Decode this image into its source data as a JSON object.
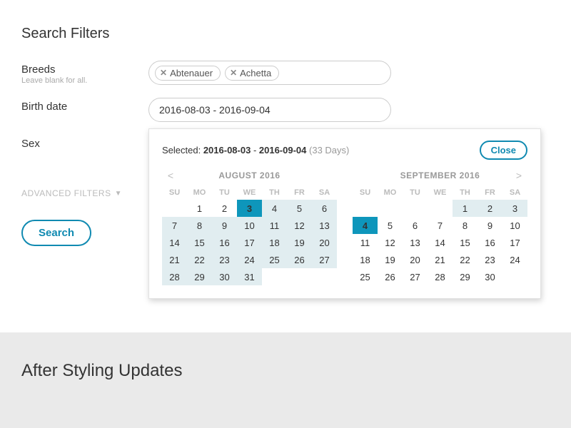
{
  "heading": "Search Filters",
  "breeds": {
    "label": "Breeds",
    "sub": "Leave blank for all.",
    "tags": [
      "Abtenauer",
      "Achetta"
    ]
  },
  "birthdate": {
    "label": "Birth date",
    "value": "2016-08-03 - 2016-09-04"
  },
  "sex": {
    "label": "Sex"
  },
  "advanced": "ADVANCED FILTERS",
  "searchBtn": "Search",
  "datePanel": {
    "selectedLabel": "Selected:",
    "start": "2016-08-03",
    "end": "2016-09-04",
    "durationText": "(33 Days)",
    "close": "Close",
    "dow": [
      "SU",
      "MO",
      "TU",
      "WE",
      "TH",
      "FR",
      "SA"
    ],
    "month1": {
      "title": "AUGUST 2016",
      "firstDow": 1,
      "days": 31,
      "rangeFrom": 3,
      "rangeTo": 31,
      "endpoint": 3
    },
    "month2": {
      "title": "SEPTEMBER 2016",
      "firstDow": 4,
      "days": 30,
      "rangeFrom": 1,
      "rangeTo": 4,
      "endpoint": 4
    }
  },
  "footer": "After Styling Updates"
}
